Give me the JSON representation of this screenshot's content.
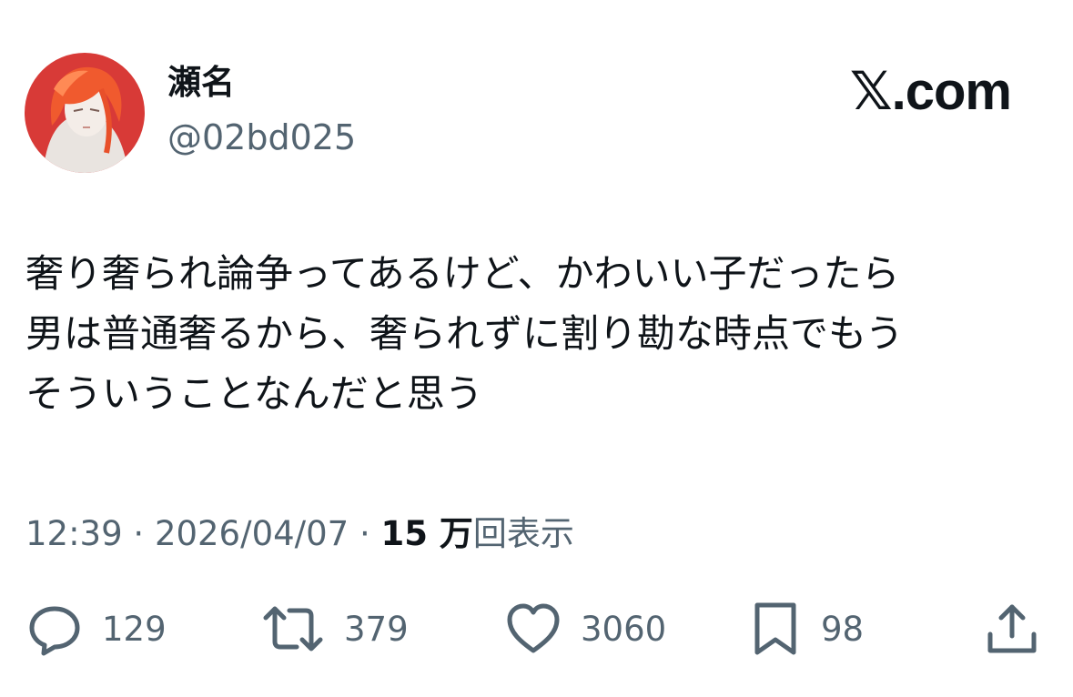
{
  "user": {
    "display_name": "瀬名",
    "handle": "@02bd025",
    "avatar_icon": "profile-avatar-red-hair-illustration"
  },
  "brand": {
    "label": "𝕏.com"
  },
  "tweet": {
    "lines": [
      "奢り奢られ論争ってあるけど、かわいい子だったら",
      "男は普通奢るから、奢られずに割り勘な時点でもう",
      "そういうことなんだと思う"
    ]
  },
  "meta": {
    "time": "12:39",
    "separator": "·",
    "date": "2026/04/07",
    "views_count": "15 万",
    "views_label": "回表示"
  },
  "actions": {
    "reply": {
      "icon": "reply-icon",
      "count": "129"
    },
    "repost": {
      "icon": "repost-icon",
      "count": "379"
    },
    "like": {
      "icon": "heart-icon",
      "count": "3060"
    },
    "bookmark": {
      "icon": "bookmark-icon",
      "count": "98"
    },
    "share": {
      "icon": "share-icon"
    }
  },
  "colors": {
    "text_primary": "#0f1419",
    "text_secondary": "#536471",
    "avatar_background": "#d83a37"
  }
}
